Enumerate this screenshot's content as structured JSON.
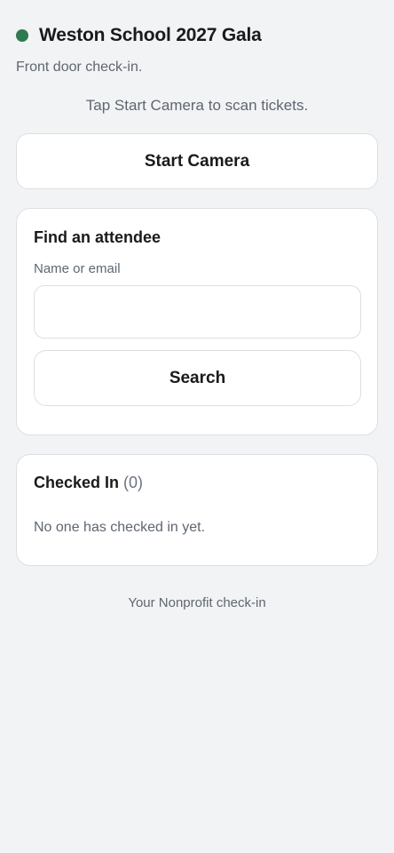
{
  "header": {
    "title": "Weston School 2027 Gala",
    "subtitle": "Front door check-in.",
    "status_color": "#2f7a4f"
  },
  "scanner": {
    "instruction": "Tap Start Camera to scan tickets.",
    "start_label": "Start Camera"
  },
  "search": {
    "title": "Find an attendee",
    "field_label": "Name or email",
    "value": "",
    "placeholder": "",
    "button_label": "Search"
  },
  "checked_in": {
    "title": "Checked In",
    "count": "(0)",
    "empty_text": "No one has checked in yet."
  },
  "footer": {
    "text": "Your Nonprofit check-in"
  }
}
